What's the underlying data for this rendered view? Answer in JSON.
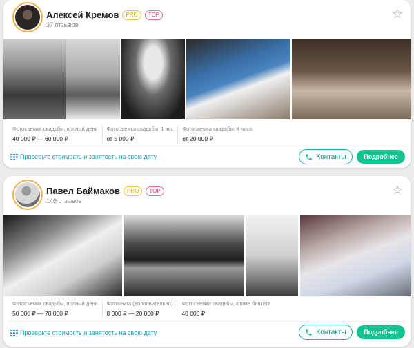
{
  "cards": [
    {
      "name": "Алексей Кремов",
      "badge_pro": "PRO",
      "badge_top": "TOP",
      "reviews": "37 отзывов",
      "prices": [
        {
          "label": "Фотосъемка свадьбы, полный день",
          "value": "40 000 ₽ — 60 000 ₽"
        },
        {
          "label": "Фотосъемка свадьбы, 1 час",
          "value": "от 5 000 ₽"
        },
        {
          "label": "Фотосъемка свадьбы, 4 часа",
          "value": "от 20 000 ₽"
        }
      ],
      "check_link": "Проверьте стоимость и занятость на свою дату",
      "contacts_label": "Контакты",
      "more_label": "Подробнее"
    },
    {
      "name": "Павел Баймаков",
      "badge_pro": "PRO",
      "badge_top": "TOP",
      "reviews": "146 отзывов",
      "prices": [
        {
          "label": "Фотосъемка свадьбы, полный день",
          "value": "50 000 ₽ — 70 000 ₽"
        },
        {
          "label": "Фотокнига (дополнительно)",
          "value": "8 000 ₽ — 20 000 ₽"
        },
        {
          "label": "Фотосъемка свадьбы, кроме банкета",
          "value": "40 000 ₽"
        }
      ],
      "check_link": "Проверьте стоимость и занятость на свою дату",
      "contacts_label": "Контакты",
      "more_label": "Подробнее"
    }
  ],
  "colors": {
    "accent_teal": "#16b6a8",
    "accent_green": "#12c48f",
    "badge_pro": "#e3a000",
    "badge_top": "#d6336c",
    "link": "#1aa0b8"
  }
}
